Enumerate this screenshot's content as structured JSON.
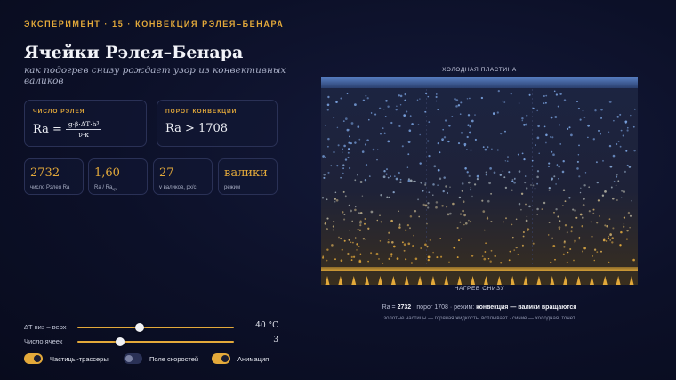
{
  "header": {
    "eyebrow": "ЭКСПЕРИМЕНТ · 15 · КОНВЕКЦИЯ РЭЛЕЯ–БЕНАРА",
    "title": "Ячейки Рэлея–Бенара",
    "subtitle": "как подогрев снизу рождает узор из конвективных валиков"
  },
  "formula_card": {
    "label": "ЧИСЛО РЭЛЕЯ",
    "lhs": "Ra =",
    "numerator": "g·β·ΔT·h³",
    "denominator": "ν·κ"
  },
  "threshold_card": {
    "label": "ПОРОГ КОНВЕКЦИИ",
    "value": "Ra > 1708"
  },
  "stats": {
    "rayleigh": {
      "value": "2732",
      "label": "число Рэлея Ra"
    },
    "ratio": {
      "value": "1,60",
      "label": "Ra / Ra",
      "label_sub": "кр"
    },
    "speed": {
      "value": "27",
      "label": "v валиков, px/c"
    },
    "mode": {
      "value": "валики",
      "label": "режим"
    }
  },
  "controls": {
    "delta_t": {
      "label": "ΔT низ – верх",
      "value_text": "40 °C",
      "level": 0.4
    },
    "cells": {
      "label": "Число ячеек",
      "value_text": "3",
      "level": 0.27
    },
    "tracers": {
      "label": "Частицы-трассеры",
      "on": true
    },
    "velocity_field": {
      "label": "Поле скоростей",
      "on": false
    },
    "animation": {
      "label": "Анимация",
      "on": true
    }
  },
  "simulation": {
    "top_caption": "ХОЛОДНАЯ ПЛАСТИНА",
    "bottom_caption": "НАГРЕВ СНИЗУ",
    "cold_color": "#4d74b8",
    "hot_color": "#e3a93a",
    "cell_count": 3
  },
  "status": {
    "prefix": "Ra = ",
    "ra": "2732",
    "mid": " · порог 1708 · режим: ",
    "mode": "конвекция — валики вращаются",
    "legend": "золотые частицы — горячая жидкость, всплывает · синие — холодная, тонет"
  },
  "colors": {
    "accent": "#e3a93a",
    "background": "#0c1028"
  }
}
